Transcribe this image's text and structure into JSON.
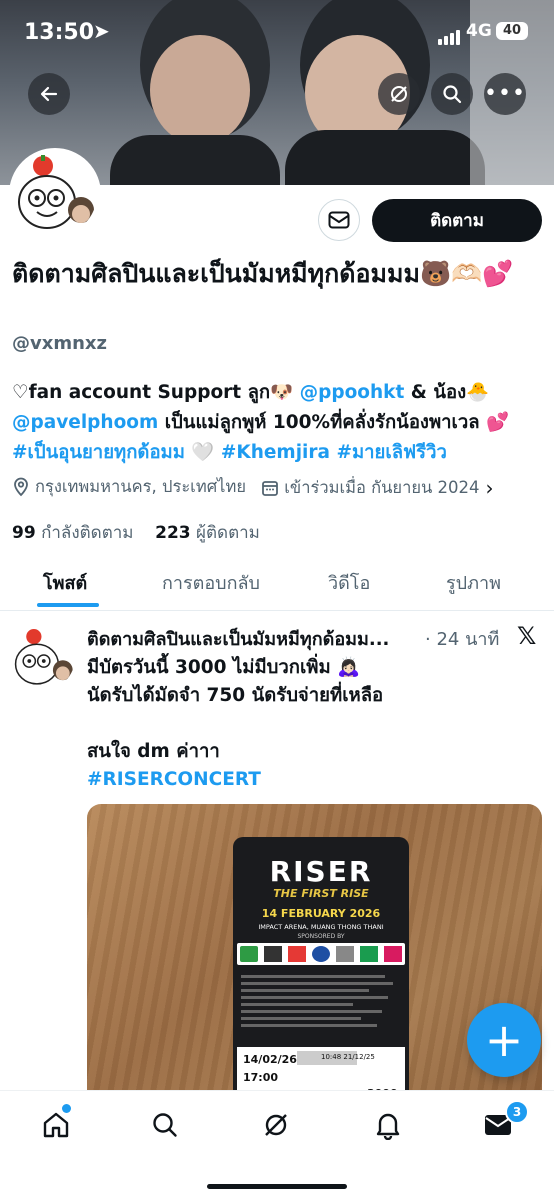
{
  "status_bar": {
    "time": "13:50",
    "network": "4G",
    "battery": "40"
  },
  "profile": {
    "display_name": "ติดตามศิลปินและเป็นมัมหมีทุกด้อมมม🐻🫶🏻💕",
    "handle": "@vxmnxz",
    "follow_label": "ติดตาม",
    "bio": {
      "part1": "♡fan account Support ลูก🐶 ",
      "mention1": "@ppoohkt",
      "part2": " & น้อง🐣 ",
      "mention2": "@pavelphoom",
      "part3": " เป็นแม่ลูกพูห์ 100%ที่คลั่งรักน้องพาเวล 💕 ",
      "tag1": "#เป็นอุนยายทุกด้อมม",
      "part4": " 🤍 ",
      "tag2": "#Khemjira",
      "part5": " ",
      "tag3": "#มายเลิฟรีวิว"
    },
    "location": "กรุงเทพมหานคร, ประเทศไทย",
    "joined": "เข้าร่วมเมื่อ กันยายน 2024",
    "following_count": "99",
    "following_label": "กำลังติดตาม",
    "followers_count": "223",
    "followers_label": "ผู้ติดตาม"
  },
  "tabs": [
    "โพสต์",
    "การตอบกลับ",
    "วิดีโอ",
    "รูปภาพ"
  ],
  "post": {
    "author": "ติดตามศิลปินและเป็นมัมหมีทุกด้อมม...",
    "time": "· 24 นาที",
    "line1": "มีบัตรวันนี้ 3000 ไม่มีบวกเพิ่ม 🙇🏻‍♀️",
    "line2": "นัดรับได้มัดจำ 750 นัดรับจ่ายที่เหลือ",
    "line3": "สนใจ dm ค่าาา",
    "hashtag": "#RISERCONCERT"
  },
  "ticket": {
    "title": "RISER",
    "subtitle": "THE FIRST RISE",
    "date": "14 FEBRUARY 2026",
    "venue": "IMPACT ARENA, MUANG THONG THANI",
    "sponsored": "SPONSORED BY",
    "show_date": "14/02/26",
    "show_time": "17:00",
    "issued": "10:48  21/12/25",
    "price": "3000"
  },
  "nav": {
    "messages_badge": "3"
  },
  "colors": {
    "accent": "#1d9bf0",
    "text": "#0f1419",
    "muted": "#536471"
  }
}
